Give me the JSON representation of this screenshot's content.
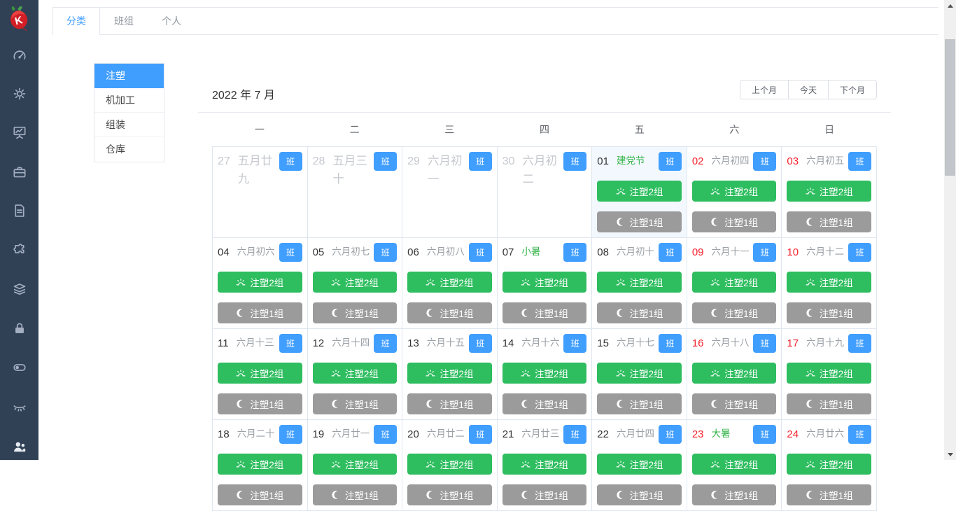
{
  "sidebar": {
    "logo_letter": "K",
    "icons": [
      "dashboard-icon",
      "gear-icon",
      "monitor-chart-icon",
      "briefcase-icon",
      "document-icon",
      "puzzle-icon",
      "layers-icon",
      "lock-icon",
      "toggle-icon",
      "eye-closed-icon",
      "users-icon"
    ]
  },
  "tabs": [
    {
      "id": "category",
      "label": "分类",
      "active": true
    },
    {
      "id": "team",
      "label": "班组",
      "active": false
    },
    {
      "id": "personal",
      "label": "个人",
      "active": false
    }
  ],
  "category_menu": [
    {
      "id": "injection",
      "label": "注塑",
      "selected": true
    },
    {
      "id": "machining",
      "label": "机加工",
      "selected": false
    },
    {
      "id": "assembly",
      "label": "组装",
      "selected": false
    },
    {
      "id": "warehouse",
      "label": "仓库",
      "selected": false
    }
  ],
  "calendar": {
    "title": "2022 年 7 月",
    "nav_buttons": [
      {
        "id": "prev-month",
        "label": "上个月"
      },
      {
        "id": "today",
        "label": "今天"
      },
      {
        "id": "next-month",
        "label": "下个月"
      }
    ],
    "weekdays": [
      "一",
      "二",
      "三",
      "四",
      "五",
      "六",
      "日"
    ],
    "badge_label": "班",
    "event_types": {
      "day": {
        "label": "注塑2组",
        "icon": "sunrise-icon",
        "color": "#2ebd5f"
      },
      "night": {
        "label": "注塑1组",
        "icon": "moon-icon",
        "color": "#9b9b9b"
      }
    },
    "weeks": [
      [
        {
          "date": "27",
          "lunar": "五月廿九",
          "muted": true
        },
        {
          "date": "28",
          "lunar": "五月三十",
          "muted": true
        },
        {
          "date": "29",
          "lunar": "六月初一",
          "muted": true
        },
        {
          "date": "30",
          "lunar": "六月初二",
          "muted": true
        },
        {
          "date": "01",
          "lunar": "建党节",
          "festival": true,
          "selected": true,
          "has_events": true
        },
        {
          "date": "02",
          "lunar": "六月初四",
          "weekend": true,
          "has_events": true
        },
        {
          "date": "03",
          "lunar": "六月初五",
          "weekend": true,
          "has_events": true
        }
      ],
      [
        {
          "date": "04",
          "lunar": "六月初六",
          "has_events": true
        },
        {
          "date": "05",
          "lunar": "六月初七",
          "has_events": true
        },
        {
          "date": "06",
          "lunar": "六月初八",
          "has_events": true
        },
        {
          "date": "07",
          "lunar": "小暑",
          "festival": true,
          "has_events": true
        },
        {
          "date": "08",
          "lunar": "六月初十",
          "has_events": true
        },
        {
          "date": "09",
          "lunar": "六月十一",
          "weekend": true,
          "has_events": true
        },
        {
          "date": "10",
          "lunar": "六月十二",
          "weekend": true,
          "has_events": true
        }
      ],
      [
        {
          "date": "11",
          "lunar": "六月十三",
          "has_events": true
        },
        {
          "date": "12",
          "lunar": "六月十四",
          "has_events": true
        },
        {
          "date": "13",
          "lunar": "六月十五",
          "has_events": true
        },
        {
          "date": "14",
          "lunar": "六月十六",
          "has_events": true
        },
        {
          "date": "15",
          "lunar": "六月十七",
          "has_events": true
        },
        {
          "date": "16",
          "lunar": "六月十八",
          "weekend": true,
          "has_events": true
        },
        {
          "date": "17",
          "lunar": "六月十九",
          "weekend": true,
          "has_events": true
        }
      ],
      [
        {
          "date": "18",
          "lunar": "六月二十",
          "has_events": true
        },
        {
          "date": "19",
          "lunar": "六月廿一",
          "has_events": true
        },
        {
          "date": "20",
          "lunar": "六月廿二",
          "has_events": true
        },
        {
          "date": "21",
          "lunar": "六月廿三",
          "has_events": true
        },
        {
          "date": "22",
          "lunar": "六月廿四",
          "has_events": true
        },
        {
          "date": "23",
          "lunar": "大暑",
          "weekend": true,
          "festival": true,
          "has_events": true
        },
        {
          "date": "24",
          "lunar": "六月廿六",
          "weekend": true,
          "has_events": true
        }
      ]
    ]
  },
  "colors": {
    "sidebar_bg": "#304156",
    "accent_blue": "#409eff",
    "event_day_green": "#2ebd5f",
    "event_night_gray": "#9b9b9b",
    "weekend_red": "#f5222d",
    "festival_green": "#34b348",
    "selected_day_bg": "#f2f8fe"
  }
}
